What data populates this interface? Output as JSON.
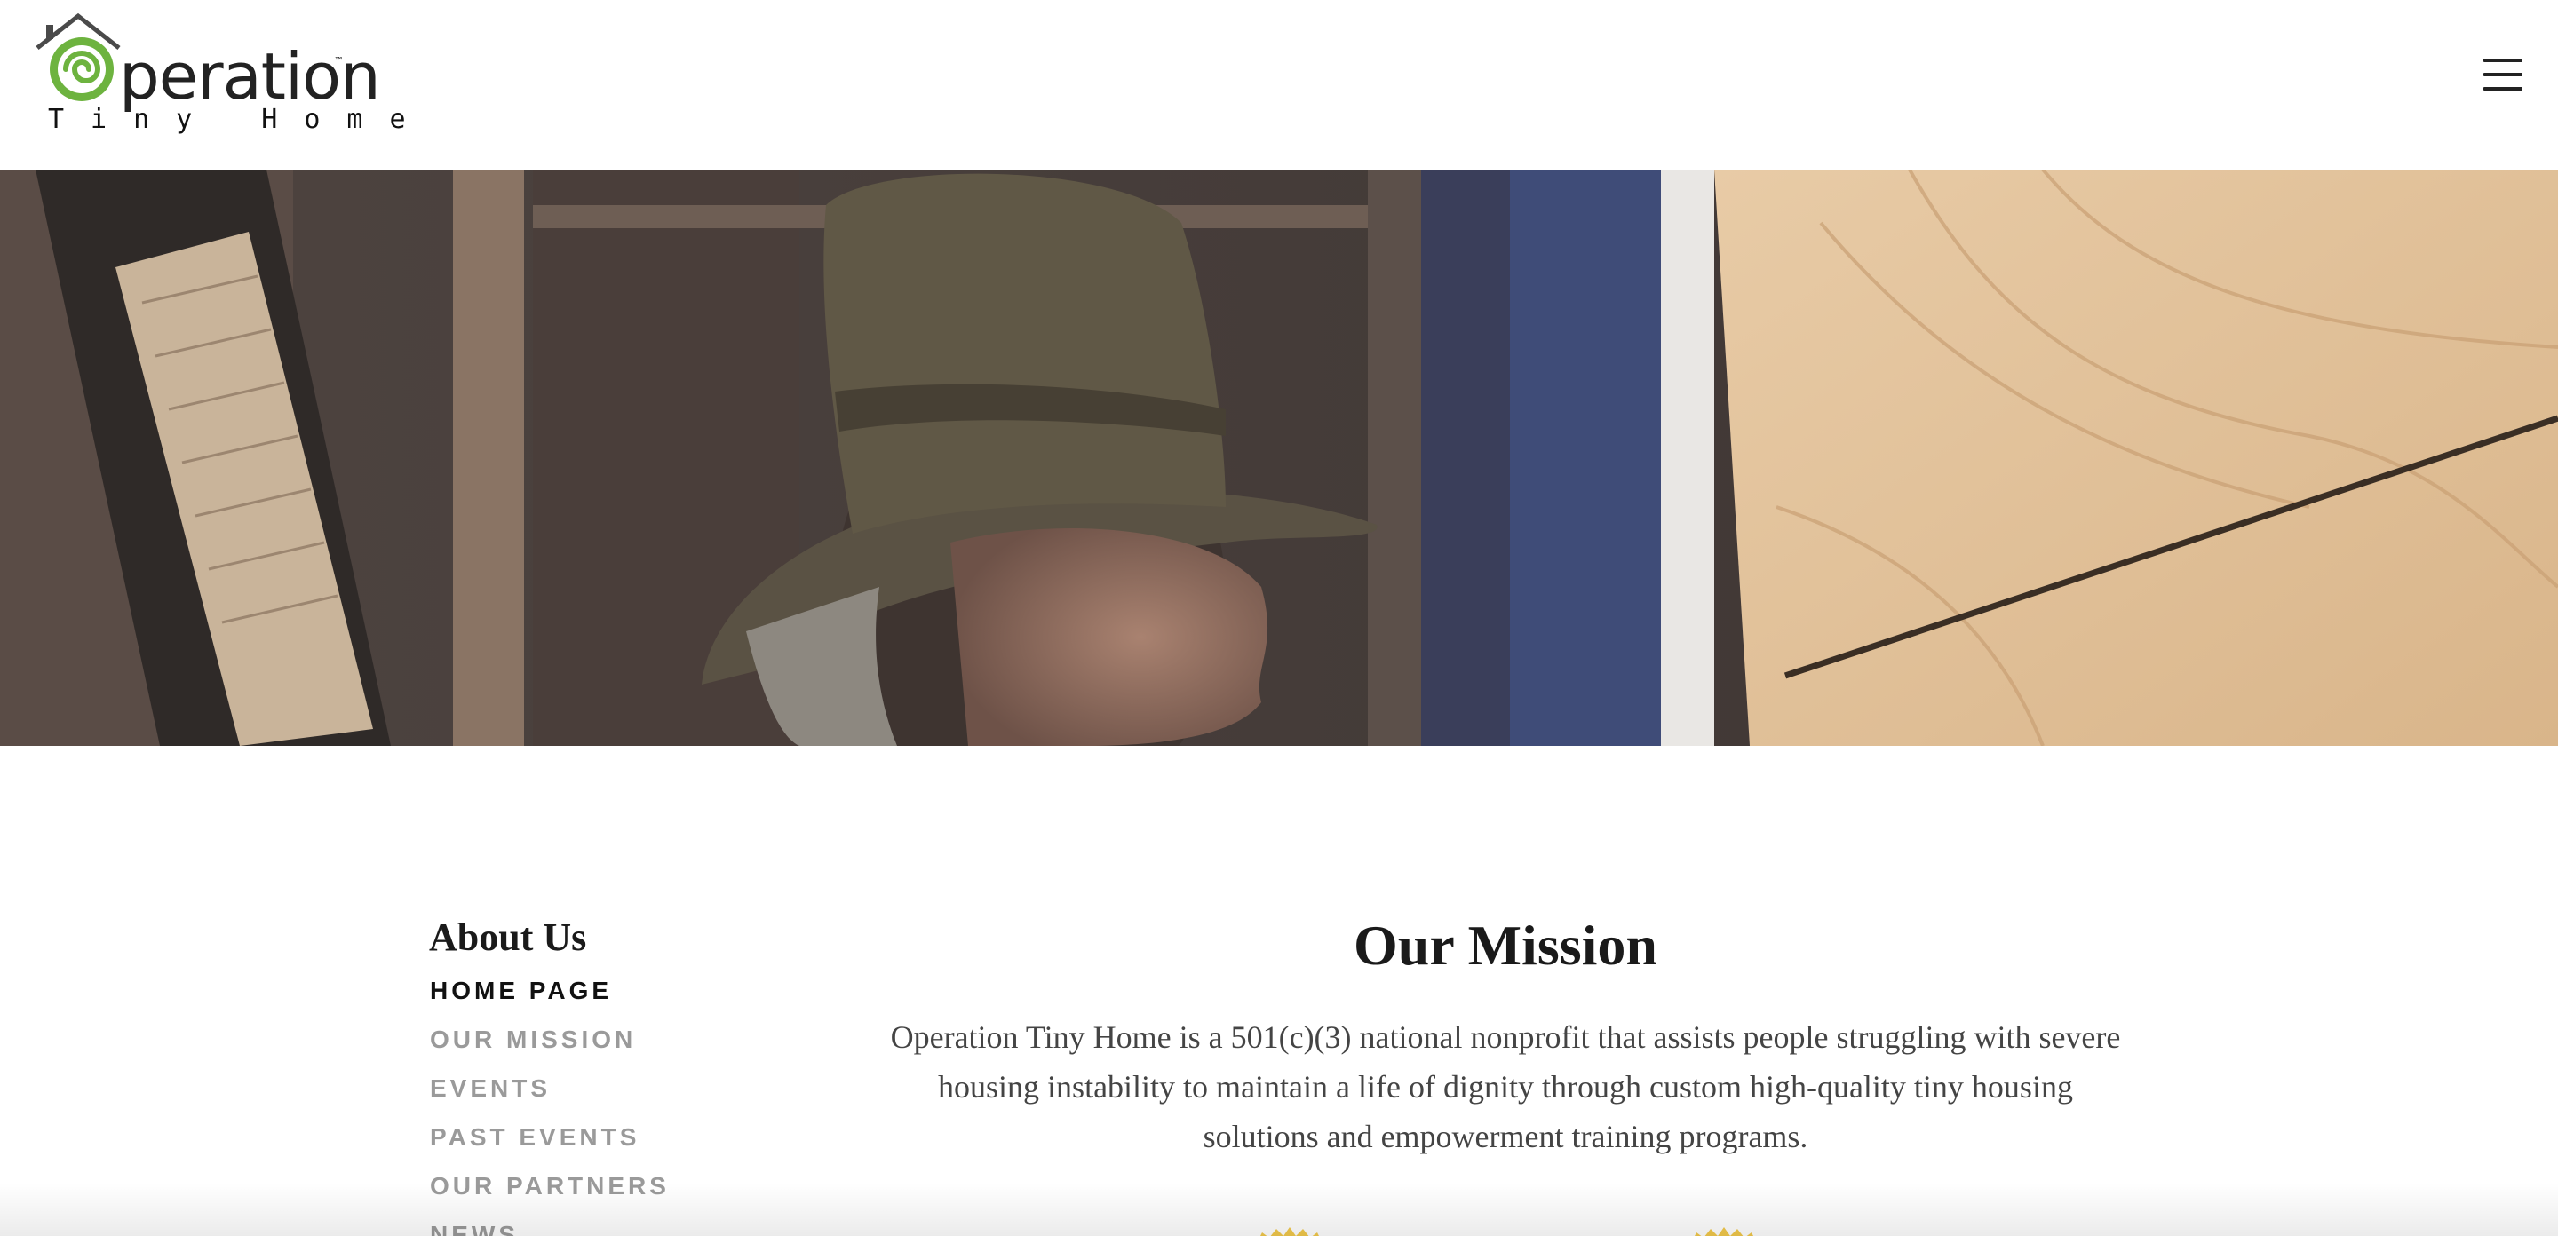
{
  "header": {
    "logo_word": "peration",
    "logo_trademark": "™",
    "logo_tagline": "Tiny Home",
    "menu_icon": "hamburger-menu-icon"
  },
  "hero": {
    "image": "man-in-hat-inside-tiny-home-construction"
  },
  "sidebar": {
    "title": "About Us",
    "items": [
      {
        "label": "HOME PAGE",
        "active": true
      },
      {
        "label": "OUR MISSION",
        "active": false
      },
      {
        "label": "EVENTS",
        "active": false
      },
      {
        "label": "PAST EVENTS",
        "active": false
      },
      {
        "label": "OUR PARTNERS",
        "active": false
      },
      {
        "label": "NEWS",
        "active": false
      }
    ]
  },
  "main": {
    "title": "Our Mission",
    "body": "Operation Tiny Home is a 501(c)(3) national nonprofit that assists people struggling with severe housing instability to maintain a life of dignity through custom high-quality tiny housing solutions and empowerment training programs."
  },
  "colors": {
    "logo_green": "#6db33f",
    "badge_yellow": "#f2c94c",
    "nav_inactive": "#9a9a9a"
  }
}
